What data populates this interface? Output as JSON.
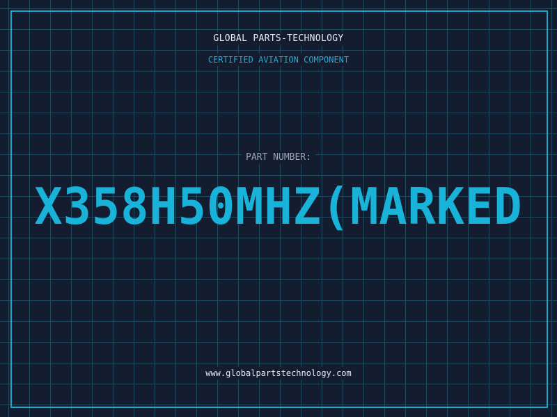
{
  "header": {
    "company": "GLOBAL PARTS-TECHNOLOGY",
    "tagline": "CERTIFIED AVIATION COMPONENT"
  },
  "part": {
    "label": "PART NUMBER:",
    "number": "X358H50MHZ(MARKED"
  },
  "footer": {
    "website": "www.globalpartstechnology.com"
  },
  "colors": {
    "background": "#141c30",
    "grid": "#1f4a60",
    "frame": "#20a6c8",
    "accent": "#19b2d8",
    "text_light": "#e6eaf0",
    "text_muted": "#9aa3b2"
  }
}
